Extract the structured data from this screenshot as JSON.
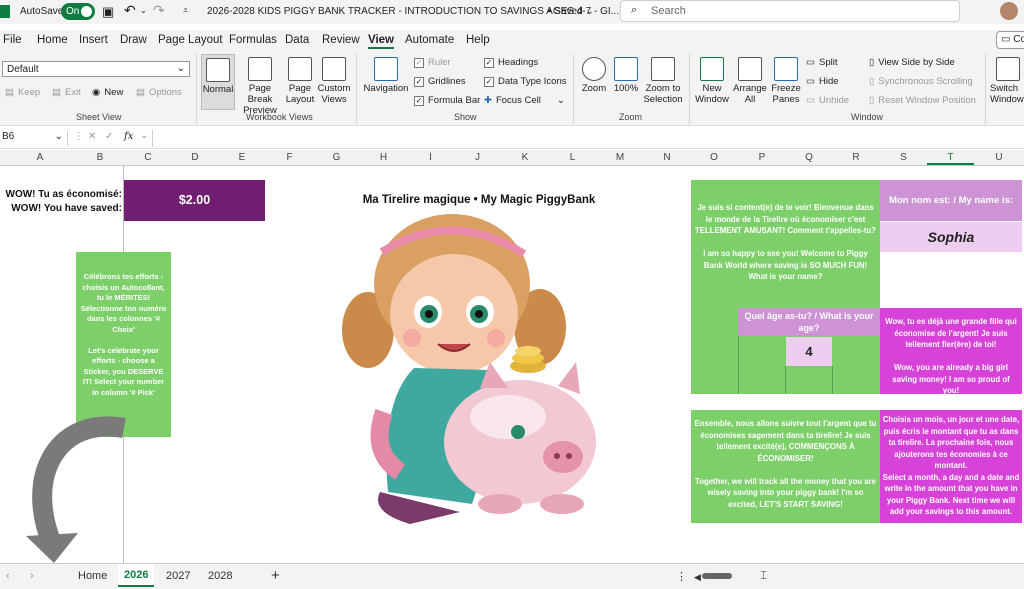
{
  "titlebar": {
    "autosave": "AutoSave",
    "toggle": "On",
    "doc_title": "2026-2028 KIDS PIGGY BANK TRACKER - INTRODUCTION TO SAVINGS AGES 4-7 - GI...",
    "saved": "Saved",
    "search_placeholder": "Search"
  },
  "menu": {
    "items": [
      "File",
      "Home",
      "Insert",
      "Draw",
      "Page Layout",
      "Formulas",
      "Data",
      "Review",
      "View",
      "Automate",
      "Help"
    ],
    "active": "View",
    "share": "Co"
  },
  "ribbon": {
    "style_value": "Default",
    "keep": "Keep",
    "exit": "Exit",
    "new": "New",
    "options": "Options",
    "sheet_view": "Sheet View",
    "normal": "Normal",
    "page_break": "Page Break",
    "preview": "Preview",
    "page": "Page",
    "layout": "Layout",
    "custom": "Custom",
    "views": "Views",
    "workbook_views": "Workbook Views",
    "navigation": "Navigation",
    "ruler": "Ruler",
    "gridlines": "Gridlines",
    "formula_bar": "Formula Bar",
    "headings": "Headings",
    "data_type_icons": "Data Type Icons",
    "focus_cell": "Focus Cell",
    "show": "Show",
    "zoom": "Zoom",
    "zoom100": "100%",
    "zoom_to": "Zoom to",
    "selection": "Selection",
    "zoom_group": "Zoom",
    "new_window_1": "New",
    "new_window_2": "Window",
    "arrange_1": "Arrange",
    "arrange_2": "All",
    "freeze_1": "Freeze",
    "freeze_2": "Panes",
    "split": "Split",
    "hide": "Hide",
    "unhide": "Unhide",
    "side_by_side": "View Side by Side",
    "sync_scroll": "Synchronous Scrolling",
    "reset_pos": "Reset Window Position",
    "window": "Window",
    "switch_1": "Switch",
    "switch_2": "Window"
  },
  "formula_bar": {
    "name_box": "B6",
    "fx": "fx"
  },
  "columns": [
    "A",
    "B",
    "C",
    "D",
    "E",
    "F",
    "G",
    "H",
    "I",
    "J",
    "K",
    "L",
    "M",
    "N",
    "O",
    "P",
    "Q",
    "R",
    "S",
    "T",
    "U"
  ],
  "sheet": {
    "saved_label_fr": "WOW! Tu as économisé:",
    "saved_label_en": "WOW! You have saved:",
    "saved_amount": "$2.00",
    "title": "Ma Tirelire magique • My Magic PiggyBank",
    "sticker_text": "Célébrons tes efforts - choisis un Autocollant, tu le MÉRITES! Sélectionne ton numéro dans les colonnes '# Choix'\n\nLet's celebrate your efforts - choose a Sticker, you DESERVE IT! Select your number in column '# Pick'",
    "welcome_text": "Je suis si content(e) de te voir! Bienvenue dans le monde de la Tirelire où économiser c'est TELLEMENT AMUSANT! Comment t'appelles-tu?\n\nI am so happy to see you! Welcome to Piggy Bank World where saving is SO MUCH FUN! What is your name?",
    "name_label": "Mon nom est: / My name is:",
    "name_value": "Sophia",
    "age_label": "Quel âge as-tu? / What is your age?",
    "age_value": "4",
    "proud_text": "Wow, tu es déjà une grande fille qui économise de l'argent! Je suis tellement fier(ère) de toi!\n\nWow, you are already a big girl saving money! I am so proud of you!",
    "together_text": "Ensemble, nous allons suivre tout l'argent que tu économises sagement dans ta tirelire! Je suis tellement excité(e), COMMENÇONS À ÉCONOMISER!\n\nTogether, we will track all the money that you are wisely saving into your piggy bank! I'm so excited, LET'S START SAVING!",
    "month_text": "Choisis un mois, un jour et une date, puis écris le montant que tu as dans ta tirelire. La prochaine fois, nous ajouterons tes économies à ce montant.\nSelect a month, a day and a date and write in the amount that you have in your Piggy Bank. Next time we will add your savings to this amount."
  },
  "tabs": {
    "items": [
      "Home",
      "2026",
      "2027",
      "2028"
    ],
    "active": "2026",
    "add": "+"
  },
  "colors": {
    "purple": "#6f1e70",
    "green": "#7dcf6a",
    "magenta": "#d743d8",
    "lilac": "#cd93d5",
    "excel_green": "#107c41"
  }
}
